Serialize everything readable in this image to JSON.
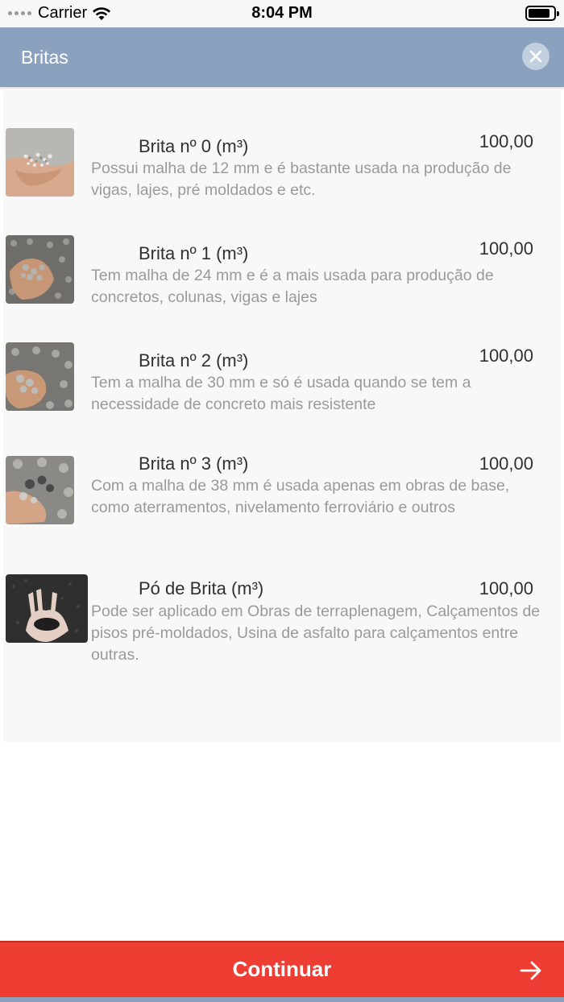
{
  "status_bar": {
    "carrier": "Carrier",
    "time": "8:04 PM"
  },
  "header": {
    "title": "Britas"
  },
  "items": [
    {
      "name": "Brita nº 0 (m³)",
      "price": "100,00",
      "description": "Possui malha de 12 mm e é bastante usada na produção de vigas, lajes, pré moldados e etc."
    },
    {
      "name": "Brita nº 1 (m³)",
      "price": "100,00",
      "description": "Tem malha de 24 mm e é a mais usada para produção de concretos, colunas, vigas e lajes"
    },
    {
      "name": "Brita nº 2 (m³)",
      "price": "100,00",
      "description": "Tem a malha de 30 mm e só é usada quando se tem a necessidade de concreto mais resistente"
    },
    {
      "name": "Brita nº 3 (m³)",
      "price": "100,00",
      "description": "Com a malha de 38 mm é usada apenas em obras de base, como aterramentos, nivelamento ferroviário e outros"
    },
    {
      "name": "Pó de Brita (m³)",
      "price": "100,00",
      "description": "Pode ser aplicado em Obras de terraplenagem, Calçamentos de pisos pré-moldados, Usina de asfalto para calçamentos entre outras."
    }
  ],
  "footer": {
    "continue_label": "Continuar"
  },
  "colors": {
    "header": "#8aa2be",
    "button": "#ee3e33",
    "list_bg": "#f8f8f8"
  }
}
